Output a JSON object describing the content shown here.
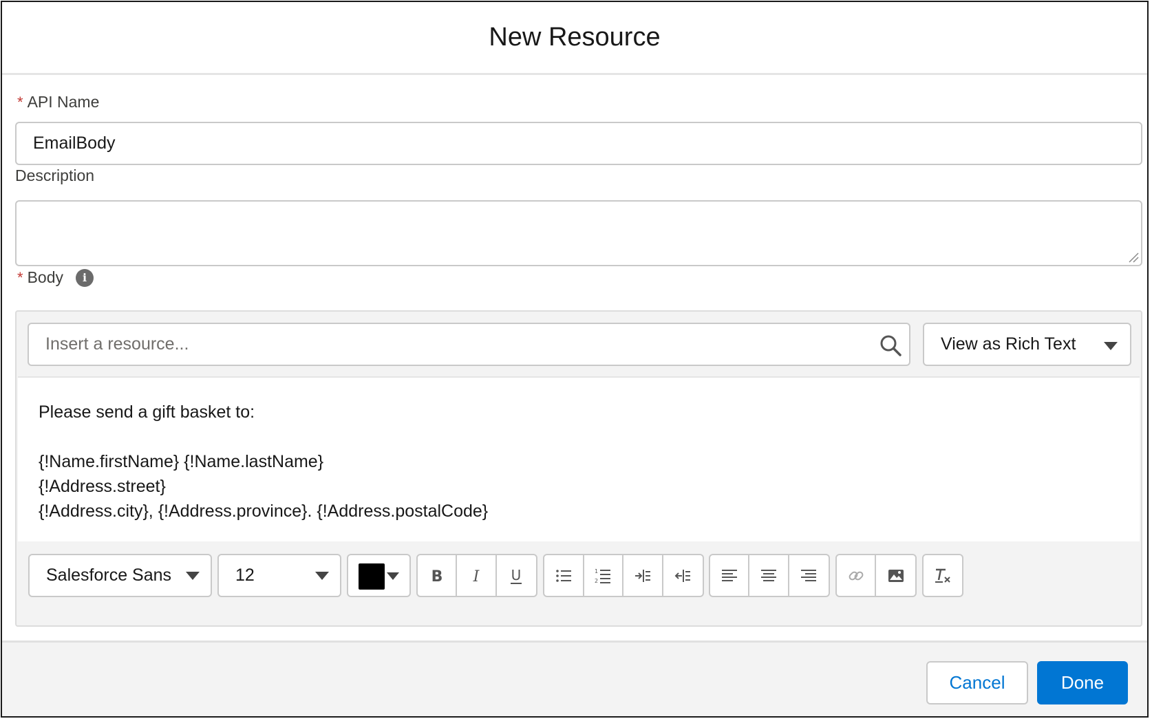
{
  "modal": {
    "title": "New Resource"
  },
  "api_name": {
    "required_mark": "*",
    "label": "API Name",
    "value": "EmailBody"
  },
  "description": {
    "label": "Description",
    "value": ""
  },
  "body": {
    "required_mark": "*",
    "label": "Body",
    "info_icon": "info-icon",
    "resource_search": {
      "placeholder": "Insert a resource...",
      "icon": "search-icon"
    },
    "view_mode": {
      "selected": "View as Rich Text"
    },
    "editor_lines": [
      "Please send a gift basket to:",
      "",
      "{!Name.firstName} {!Name.lastName}",
      "{!Address.street}",
      "{!Address.city}, {!Address.province}. {!Address.postalCode}"
    ],
    "toolbar": {
      "font_family": "Salesforce Sans",
      "font_size": "12",
      "text_color": "#000000",
      "buttons": [
        "bold",
        "italic",
        "underline",
        "bulleted-list",
        "numbered-list",
        "indent",
        "outdent",
        "align-left",
        "align-center",
        "align-right",
        "link",
        "image",
        "clear-formatting"
      ]
    }
  },
  "footer": {
    "cancel_label": "Cancel",
    "done_label": "Done"
  },
  "colors": {
    "brand": "#0176d3",
    "required": "#c23934"
  }
}
